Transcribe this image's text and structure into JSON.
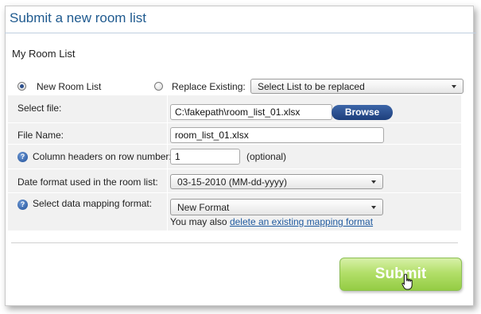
{
  "dialog": {
    "title": "Submit a new room list"
  },
  "section": {
    "title": "My Room List"
  },
  "mode": {
    "new_label": "New Room List",
    "new_selected": true,
    "replace_label": "Replace Existing:",
    "replace_selected": false,
    "replace_select_value": "Select List to be replaced"
  },
  "form": {
    "select_file": {
      "label": "Select file:",
      "value": "C:\\fakepath\\room_list_01.xlsx",
      "browse_label": "Browse"
    },
    "file_name": {
      "label": "File Name:",
      "value": "room_list_01.xlsx"
    },
    "header_row": {
      "label": "Column headers on row number:",
      "value": "1",
      "hint": "(optional)"
    },
    "date_format": {
      "label": "Date format used in the room list:",
      "value": "03-15-2010 (MM-dd-yyyy)"
    },
    "mapping": {
      "label": "Select data mapping format:",
      "value": "New Format",
      "note": "You may also",
      "link": "delete an existing mapping format"
    }
  },
  "submit": {
    "label": "Submit"
  },
  "icons": {
    "help": "help-icon",
    "cursor": "hand-pointer-icon",
    "dropdown": "chevron-down-icon"
  }
}
